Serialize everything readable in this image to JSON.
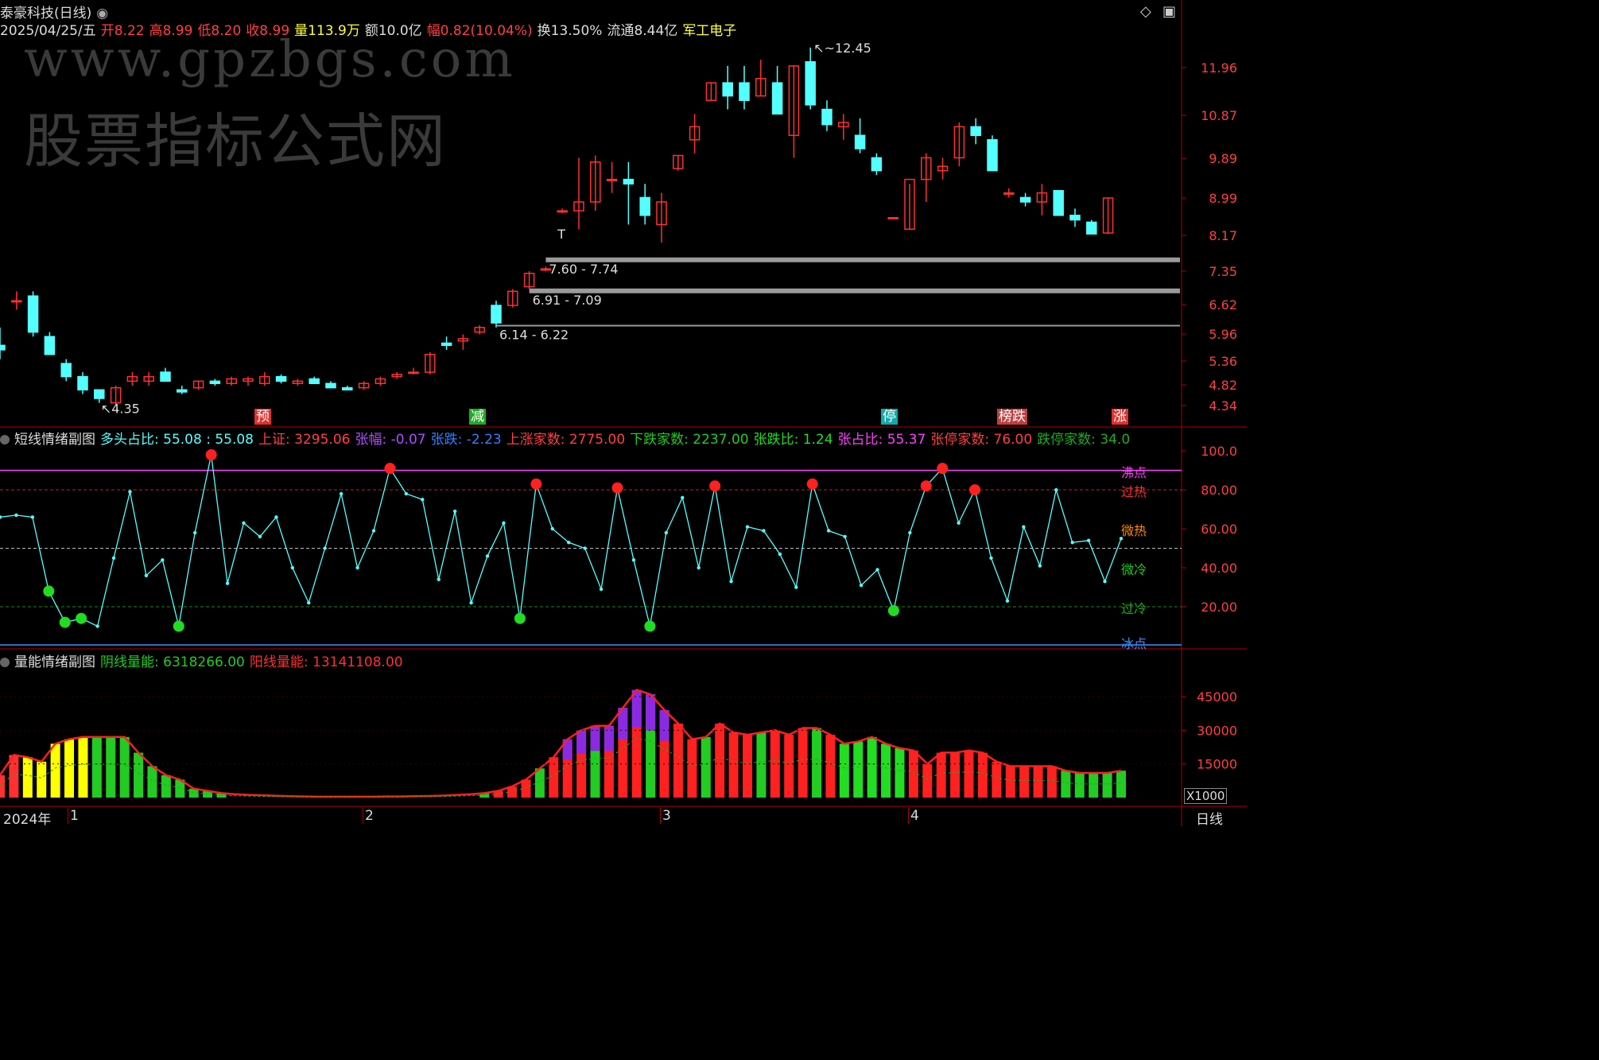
{
  "header": {
    "name": "泰豪科技(日线)",
    "date": "2025/04/25/五",
    "open": "开8.22",
    "high": "高8.99",
    "low": "低8.20",
    "close": "收8.99",
    "volume": "量113.9万",
    "amount": "额10.0亿",
    "change": "幅0.82(10.04%)",
    "turnover": "换13.50%",
    "float": "流通8.44亿",
    "sector": "军工电子"
  },
  "watermark": {
    "url": "www.gpzbgs.com",
    "name": "股票指标公式网"
  },
  "flags": [
    {
      "text": "预",
      "color": "#e03030"
    },
    {
      "text": "减",
      "color": "#22aa22"
    },
    {
      "text": "停",
      "color": "#1aa"
    },
    {
      "text": "榜跌",
      "color": "#c04040"
    },
    {
      "text": "涨",
      "color": "#e03030"
    }
  ],
  "colors": {
    "up": "#ff3030",
    "down": "#54ffff",
    "bg": "#000000",
    "axis": "#b00000"
  },
  "chart_data": [
    {
      "type": "candlestick",
      "ylabels": [
        "11.96",
        "10.87",
        "9.89",
        "8.99",
        "8.17",
        "7.35",
        "6.62",
        "5.96",
        "5.36",
        "4.82",
        "4.34"
      ],
      "annotations": [
        "12.45",
        "4.35"
      ],
      "zones": [
        "7.60 - 7.74",
        "6.91 - 7.09",
        "6.14 - 6.22"
      ],
      "ohlc": [
        [
          5.7,
          6.1,
          5.4,
          5.6
        ],
        [
          6.7,
          6.9,
          6.5,
          6.7
        ],
        [
          6.8,
          6.9,
          5.9,
          6.0
        ],
        [
          5.9,
          6.0,
          5.5,
          5.5
        ],
        [
          5.3,
          5.4,
          4.9,
          5.0
        ],
        [
          5.0,
          5.1,
          4.6,
          4.7
        ],
        [
          4.7,
          4.7,
          4.4,
          4.5
        ],
        [
          4.4,
          4.8,
          4.35,
          4.75
        ],
        [
          4.9,
          5.1,
          4.8,
          5.0
        ],
        [
          4.9,
          5.1,
          4.8,
          5.0
        ],
        [
          5.1,
          5.2,
          4.9,
          4.9
        ],
        [
          4.7,
          4.8,
          4.6,
          4.65
        ],
        [
          4.75,
          4.9,
          4.7,
          4.9
        ],
        [
          4.9,
          4.95,
          4.8,
          4.85
        ],
        [
          4.85,
          5.0,
          4.8,
          4.95
        ],
        [
          4.9,
          5.0,
          4.8,
          4.95
        ],
        [
          4.85,
          5.1,
          4.8,
          5.0
        ],
        [
          5.0,
          5.05,
          4.85,
          4.9
        ],
        [
          4.85,
          4.95,
          4.8,
          4.9
        ],
        [
          4.95,
          5.0,
          4.85,
          4.85
        ],
        [
          4.85,
          4.9,
          4.75,
          4.75
        ],
        [
          4.75,
          4.8,
          4.7,
          4.7
        ],
        [
          4.75,
          4.9,
          4.7,
          4.85
        ],
        [
          4.85,
          5.0,
          4.8,
          4.95
        ],
        [
          5.0,
          5.1,
          4.95,
          5.05
        ],
        [
          5.1,
          5.2,
          5.05,
          5.1
        ],
        [
          5.1,
          5.55,
          5.05,
          5.5
        ],
        [
          5.75,
          5.9,
          5.6,
          5.7
        ],
        [
          5.8,
          5.95,
          5.6,
          5.85
        ],
        [
          6.0,
          6.15,
          5.95,
          6.1
        ],
        [
          6.6,
          6.7,
          6.1,
          6.2
        ],
        [
          6.6,
          6.95,
          6.55,
          6.9
        ],
        [
          7.0,
          7.35,
          6.95,
          7.3
        ],
        [
          7.4,
          7.45,
          7.35,
          7.4
        ],
        [
          8.7,
          8.75,
          8.65,
          8.7
        ],
        [
          8.7,
          9.9,
          8.3,
          8.9
        ],
        [
          8.9,
          9.95,
          8.7,
          9.8
        ],
        [
          9.4,
          9.8,
          9.1,
          9.4
        ],
        [
          9.4,
          9.8,
          8.4,
          9.3
        ],
        [
          9.0,
          9.3,
          8.4,
          8.6
        ],
        [
          8.4,
          9.1,
          8.0,
          8.9
        ],
        [
          9.65,
          9.95,
          9.6,
          9.95
        ],
        [
          10.3,
          10.9,
          10.0,
          10.6
        ],
        [
          11.2,
          11.6,
          11.2,
          11.6
        ],
        [
          11.6,
          12.0,
          11.0,
          11.3
        ],
        [
          11.6,
          12.0,
          11.0,
          11.2
        ],
        [
          11.3,
          12.15,
          11.3,
          11.7
        ],
        [
          11.6,
          12.0,
          10.9,
          10.9
        ],
        [
          10.4,
          12.0,
          9.9,
          12.0
        ],
        [
          12.1,
          12.45,
          11.0,
          11.1
        ],
        [
          11.0,
          11.2,
          10.5,
          10.65
        ],
        [
          10.6,
          10.9,
          10.3,
          10.7
        ],
        [
          10.4,
          10.8,
          10.0,
          10.1
        ],
        [
          9.9,
          10.0,
          9.5,
          9.6
        ],
        [
          8.55,
          8.55,
          8.55,
          8.55
        ],
        [
          8.3,
          9.3,
          8.3,
          9.4
        ],
        [
          9.4,
          10.0,
          8.9,
          9.9
        ],
        [
          9.6,
          9.9,
          9.4,
          9.7
        ],
        [
          9.9,
          10.7,
          9.7,
          10.6
        ],
        [
          10.6,
          10.8,
          10.2,
          10.4
        ],
        [
          10.3,
          10.4,
          9.6,
          9.6
        ],
        [
          9.1,
          9.2,
          9.0,
          9.1
        ],
        [
          9.0,
          9.1,
          8.8,
          8.9
        ],
        [
          8.9,
          9.3,
          8.6,
          9.1
        ],
        [
          9.15,
          9.15,
          8.6,
          8.6
        ],
        [
          8.6,
          8.75,
          8.35,
          8.5
        ],
        [
          8.45,
          8.5,
          8.2,
          8.2
        ],
        [
          8.22,
          8.99,
          8.2,
          8.99
        ]
      ]
    },
    {
      "type": "line",
      "title": "短线情绪副图",
      "legend": [
        {
          "text": "多头占比: 55.08 : 55.08",
          "color": "#54ffff"
        },
        {
          "text": "上证: 3295.06",
          "color": "#ff4040"
        },
        {
          "text": "张幅: -0.07",
          "color": "#b04cff"
        },
        {
          "text": "张跌: -2.23",
          "color": "#3080ff"
        },
        {
          "text": "上涨家数: 2775.00",
          "color": "#ff4040"
        },
        {
          "text": "下跌家数: 2237.00",
          "color": "#22cc22"
        },
        {
          "text": "张跌比: 1.24",
          "color": "#22dd22"
        },
        {
          "text": "张占比: 55.37",
          "color": "#ff40ff"
        },
        {
          "text": "张停家数: 76.00",
          "color": "#ff4040"
        },
        {
          "text": "跌停家数: 34.0",
          "color": "#22aa22"
        }
      ],
      "ylim": [
        0,
        100
      ],
      "yticks": [
        "100.0",
        "80.00",
        "60.00",
        "40.00",
        "20.00"
      ],
      "levels": [
        {
          "text": "沸点",
          "color": "#ff40ff"
        },
        {
          "text": "过热",
          "color": "#ff3030"
        },
        {
          "text": "微热",
          "color": "#ff8c00"
        },
        {
          "text": "微冷",
          "color": "#22cc22"
        },
        {
          "text": "过冷",
          "color": "#22aa22"
        },
        {
          "text": "冰点",
          "color": "#4090ff"
        }
      ],
      "values": [
        66,
        67,
        66,
        28,
        12,
        14,
        10,
        45,
        79,
        36,
        44,
        10,
        58,
        98,
        32,
        63,
        56,
        66,
        40,
        22,
        50,
        78,
        40,
        59,
        91,
        78,
        75,
        34,
        69,
        22,
        46,
        63,
        14,
        83,
        60,
        53,
        50,
        29,
        81,
        44,
        10,
        58,
        76,
        40,
        82,
        33,
        61,
        59,
        47,
        30,
        83,
        59,
        56,
        31,
        39,
        18,
        58,
        82,
        91,
        63,
        80,
        45,
        23,
        61,
        41,
        80,
        53,
        54,
        33,
        55
      ],
      "hot_markers": [
        13,
        24,
        33,
        38,
        44,
        50,
        57,
        58,
        60
      ],
      "cold_markers": [
        3,
        4,
        5,
        11,
        32,
        40,
        55
      ]
    },
    {
      "type": "bar",
      "title": "量能情绪副图",
      "legend": [
        {
          "text": "阴线量能: 6318266.00",
          "color": "#22cc22"
        },
        {
          "text": "阳线量能: 13141108.00",
          "color": "#ff3030"
        }
      ],
      "unit": "X1000",
      "yticks": [
        "45000",
        "30000",
        "15000"
      ],
      "values": [
        10000,
        19000,
        18000,
        16000,
        24000,
        26000,
        27000,
        27000,
        27000,
        27000,
        20000,
        14000,
        10000,
        8000,
        4000,
        3000,
        2000,
        1500,
        1200,
        1000,
        800,
        600,
        500,
        400,
        400,
        400,
        400,
        400,
        500,
        500,
        600,
        700,
        900,
        1200,
        1500,
        2000,
        3000,
        5000,
        8000,
        13000,
        18000,
        26000,
        30000,
        32000,
        32000,
        40000,
        48000,
        46000,
        39000,
        33000,
        26000,
        27000,
        33000,
        29000,
        28000,
        29000,
        30000,
        28000,
        31000,
        31000,
        28000,
        24000,
        25000,
        27000,
        24000,
        22000,
        21000,
        15000,
        20000,
        20000,
        21000,
        20000,
        16000,
        14000,
        14000,
        14000,
        14000,
        12000,
        11000,
        11000,
        11000,
        12000
      ],
      "first_bar_color": [
        "#ff3030",
        "#ff3030",
        "#ffff00",
        "#ffff00",
        "#ffff00",
        "#ffff00",
        "#ffff00",
        "#22cc22",
        "#22cc22",
        "#22cc22",
        "#22cc22",
        "#22cc22",
        "#22cc22",
        "#22cc22"
      ]
    }
  ],
  "axis_labels": [
    "2024年",
    "1",
    "2",
    "3",
    "4"
  ],
  "period_tab": "日线"
}
